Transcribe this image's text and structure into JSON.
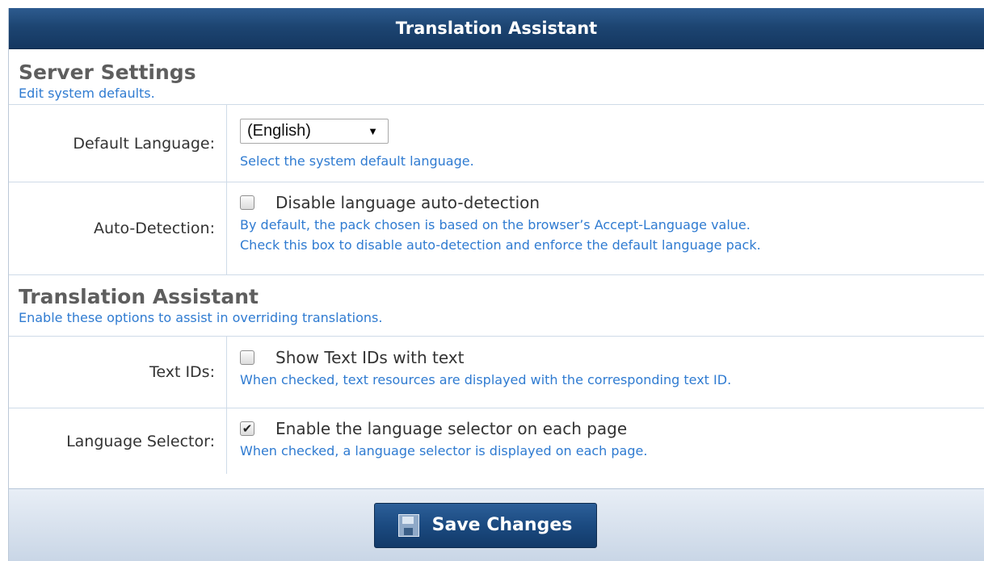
{
  "header": {
    "title": "Translation Assistant"
  },
  "server_settings": {
    "title": "Server Settings",
    "description": "Edit system defaults.",
    "default_language": {
      "label": "Default Language:",
      "selected": "(English)",
      "help": "Select the system default language."
    },
    "auto_detection": {
      "label": "Auto-Detection:",
      "checkbox_label": "Disable language auto-detection",
      "checked": false,
      "help_line1": "By default, the pack chosen is based on the browser’s Accept-Language value.",
      "help_line2": "Check this box to disable auto-detection and enforce the default language pack."
    }
  },
  "translation_assistant": {
    "title": "Translation Assistant",
    "description": "Enable these options to assist in overriding translations.",
    "text_ids": {
      "label": "Text IDs:",
      "checkbox_label": "Show Text IDs with text",
      "checked": false,
      "help": "When checked, text resources are displayed with the corresponding text ID."
    },
    "language_selector": {
      "label": "Language Selector:",
      "checkbox_label": "Enable the language selector on each page",
      "checked": true,
      "help": "When checked, a language selector is displayed on each page."
    }
  },
  "footer": {
    "save_label": "Save Changes"
  },
  "icons": {
    "dropdown": "▼",
    "checkmark": "✔",
    "save": "floppy-disk-icon"
  },
  "colors": {
    "header": "#1d4572",
    "help_text": "#2f7bd1",
    "button": "#1b4a80"
  }
}
